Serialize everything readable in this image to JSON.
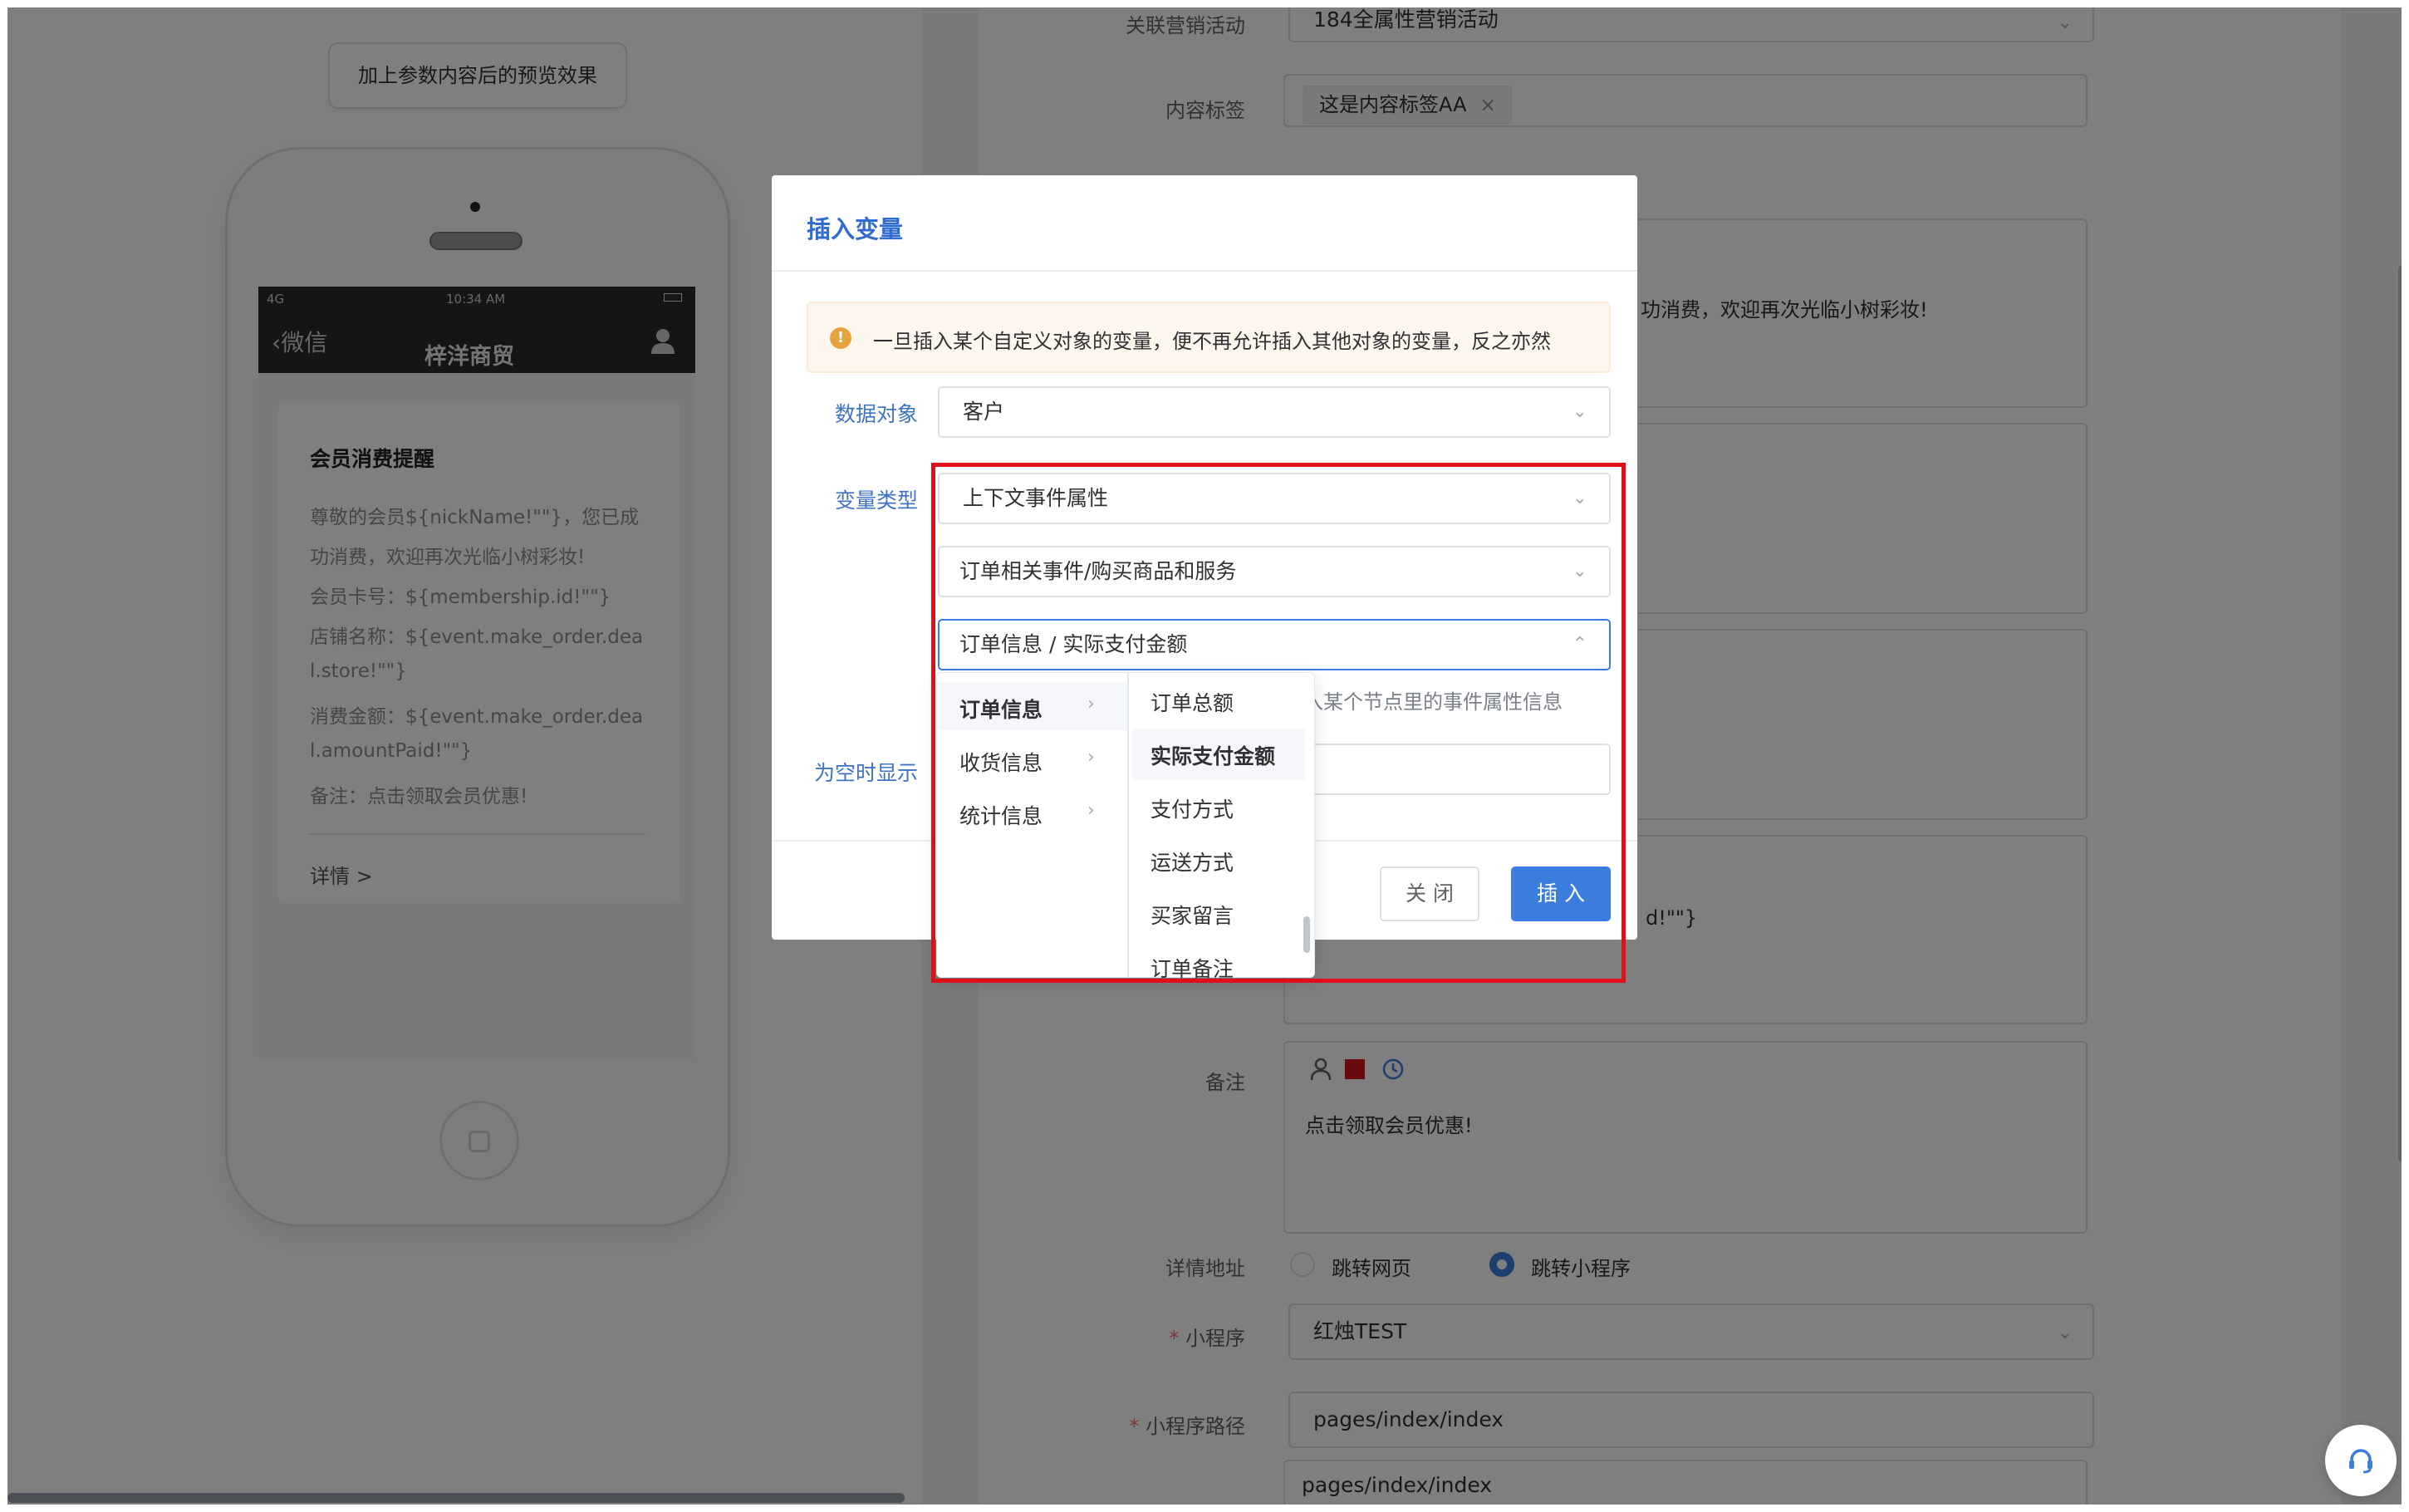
{
  "preview": {
    "button_label": "加上参数内容后的预览效果",
    "status_signal": "4G",
    "status_time": "10:34 AM",
    "back_label": "微信",
    "title": "梓洋商贸",
    "message": {
      "title": "会员消费提醒",
      "lines": [
        "尊敬的会员${nickName!\"\"}，您已成",
        "功消费，欢迎再次光临小树彩妆!",
        "会员卡号：${membership.id!\"\"}",
        "店铺名称：${event.make_order.dea",
        "l.store!\"\"}",
        "消费金额：${event.make_order.dea",
        "l.amountPaid!\"\"}",
        "备注：点击领取会员优惠!"
      ],
      "detail_label": "详情",
      "detail_arrow": ">"
    }
  },
  "form": {
    "activity_label": "关联营销活动",
    "activity_value": "184全属性营销活动",
    "tag_label": "内容标签",
    "tag_value": "这是内容标签AA",
    "tag_close": "×",
    "content_fragment_1": "功消费，欢迎再次光临小树彩妆!",
    "content_fragment_2": "d!\"\"}",
    "remark_label": "备注",
    "remark_value": "点击领取会员优惠!",
    "detail_url_label": "详情地址",
    "radio_web": "跳转网页",
    "radio_mini": "跳转小程序",
    "miniapp_label": "小程序",
    "miniapp_value": "红烛TEST",
    "path_label": "小程序路径",
    "path_value": "pages/index/index",
    "path_value_2": "pages/index/index",
    "required_mark": "*"
  },
  "dialog": {
    "title": "插入变量",
    "alert": "一旦插入某个自定义对象的变量，便不再允许插入其他对象的变量，反之亦然",
    "alert_icon": "!",
    "data_object_label": "数据对象",
    "data_object_value": "客户",
    "var_type_label": "变量类型",
    "var_type_value": "上下文事件属性",
    "event_value": "订单相关事件/购买商品和服务",
    "attr_value": "订单信息 / 实际支付金额",
    "hint": "入某个节点里的事件属性信息",
    "empty_label": "为空时显示",
    "close_label": "关 闭",
    "insert_label": "插 入"
  },
  "cascader": {
    "level1": [
      "订单信息",
      "收货信息",
      "统计信息"
    ],
    "level2": [
      "订单总额",
      "实际支付金额",
      "支付方式",
      "运送方式",
      "买家留言",
      "订单备注"
    ]
  },
  "colors": {
    "primary": "#3b7ddd",
    "highlight_box": "#e0101a",
    "warning": "#e6a23c",
    "remark_red_square": "#d0141c"
  },
  "icons": [
    "chevron-down-icon",
    "chevron-up-icon",
    "chevron-right-icon",
    "warning-icon",
    "user-icon",
    "clock-icon",
    "headset-icon",
    "close-icon"
  ]
}
